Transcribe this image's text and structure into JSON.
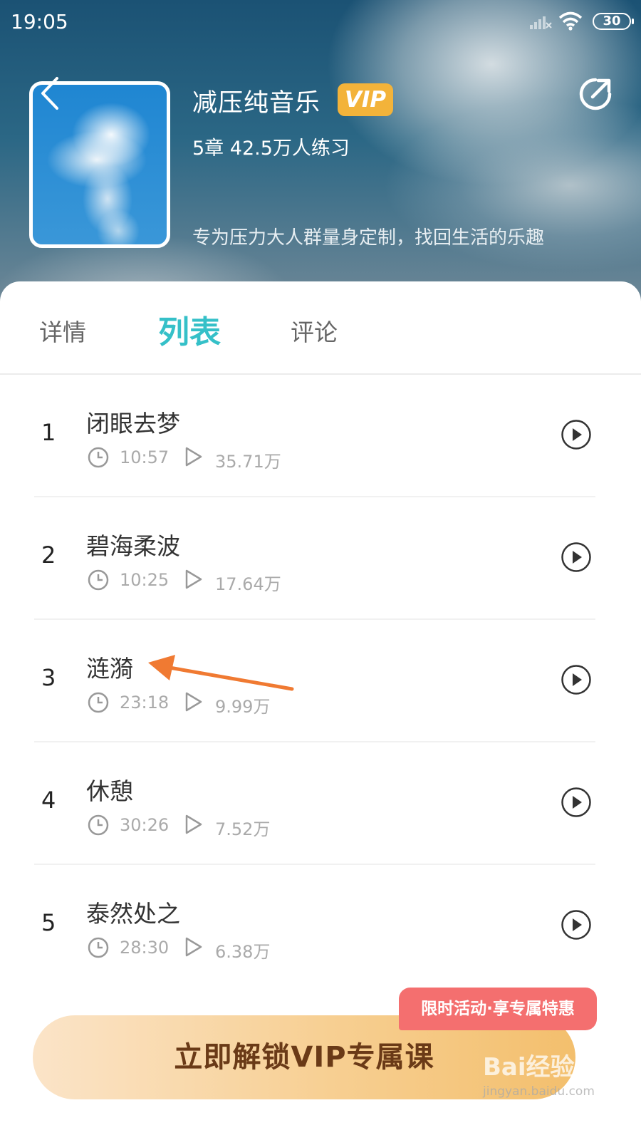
{
  "status_bar": {
    "time": "19:05",
    "battery": "30"
  },
  "course": {
    "title": "减压纯音乐",
    "vip_badge": "VIP",
    "meta": "5章 42.5万人练习",
    "description": "专为压力大人群量身定制，找回生活的乐趣"
  },
  "tabs": [
    {
      "label": "详情",
      "active": false
    },
    {
      "label": "列表",
      "active": true
    },
    {
      "label": "评论",
      "active": false
    }
  ],
  "tracks": [
    {
      "number": "1",
      "title": "闭眼去梦",
      "duration": "10:57",
      "plays": "35.71万"
    },
    {
      "number": "2",
      "title": "碧海柔波",
      "duration": "10:25",
      "plays": "17.64万"
    },
    {
      "number": "3",
      "title": "涟漪",
      "duration": "23:18",
      "plays": "9.99万"
    },
    {
      "number": "4",
      "title": "休憩",
      "duration": "30:26",
      "plays": "7.52万"
    },
    {
      "number": "5",
      "title": "泰然处之",
      "duration": "28:30",
      "plays": "6.38万"
    }
  ],
  "promo": {
    "label": "限时活动·享专属特惠"
  },
  "cta": {
    "label": "立即解锁VIP专属课"
  },
  "watermark": {
    "logo": "Bai经验",
    "sub": "jingyan.baidu.com"
  },
  "colors": {
    "accent": "#35c0c8",
    "vip": "#f3b33a",
    "promo": "#f46f6f",
    "cta_text": "#6a3a17",
    "annotation_arrow": "#f07a32"
  }
}
